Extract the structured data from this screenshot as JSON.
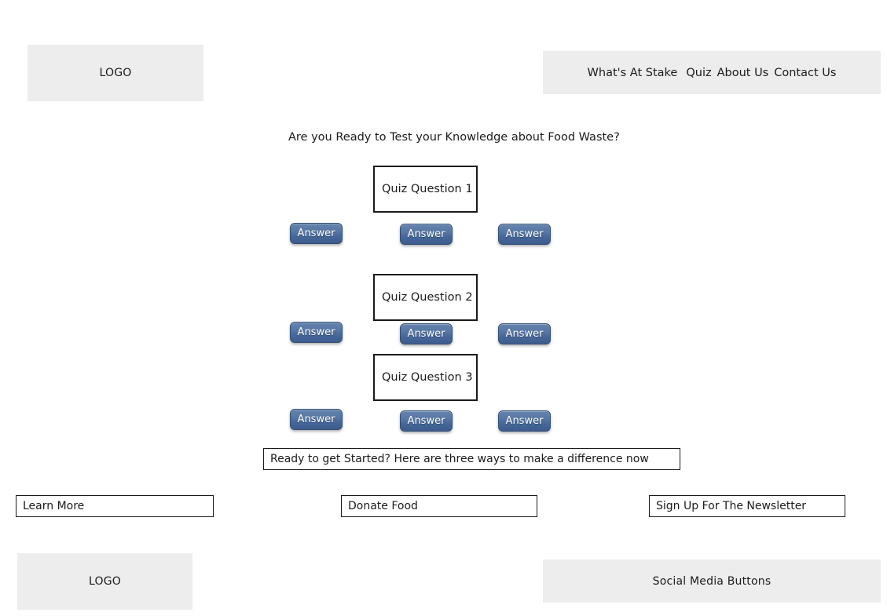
{
  "page": {
    "background_color": "#ffffff",
    "placeholder_block_color": "#ededed",
    "accent_button_color": "#4a6a99",
    "outline_color": "#1a1a1a"
  },
  "header": {
    "logo_label": "LOGO",
    "nav": {
      "items": [
        {
          "label": "What's At Stake"
        },
        {
          "label": "Quiz"
        },
        {
          "label": "About Us"
        },
        {
          "label": "Contact Us"
        }
      ]
    }
  },
  "main": {
    "headline": "Are you Ready to Test your Knowledge about Food Waste?",
    "questions": [
      {
        "question_label": "Quiz Question 1",
        "answers": [
          {
            "label": "Answer"
          },
          {
            "label": "Answer"
          },
          {
            "label": "Answer"
          }
        ]
      },
      {
        "question_label": "Quiz Question 2",
        "answers": [
          {
            "label": "Answer"
          },
          {
            "label": "Answer"
          },
          {
            "label": "Answer"
          }
        ]
      },
      {
        "question_label": "Quiz Question 3",
        "answers": [
          {
            "label": "Answer"
          },
          {
            "label": "Answer"
          },
          {
            "label": "Answer"
          }
        ]
      }
    ],
    "cta_banner": "Ready to get Started? Here are three ways to make a difference now",
    "cta_boxes": [
      {
        "label": "Learn More"
      },
      {
        "label": "Donate Food"
      },
      {
        "label": "Sign Up For The Newsletter"
      }
    ]
  },
  "footer": {
    "logo_label": "LOGO",
    "social_label": "Social Media Buttons"
  }
}
